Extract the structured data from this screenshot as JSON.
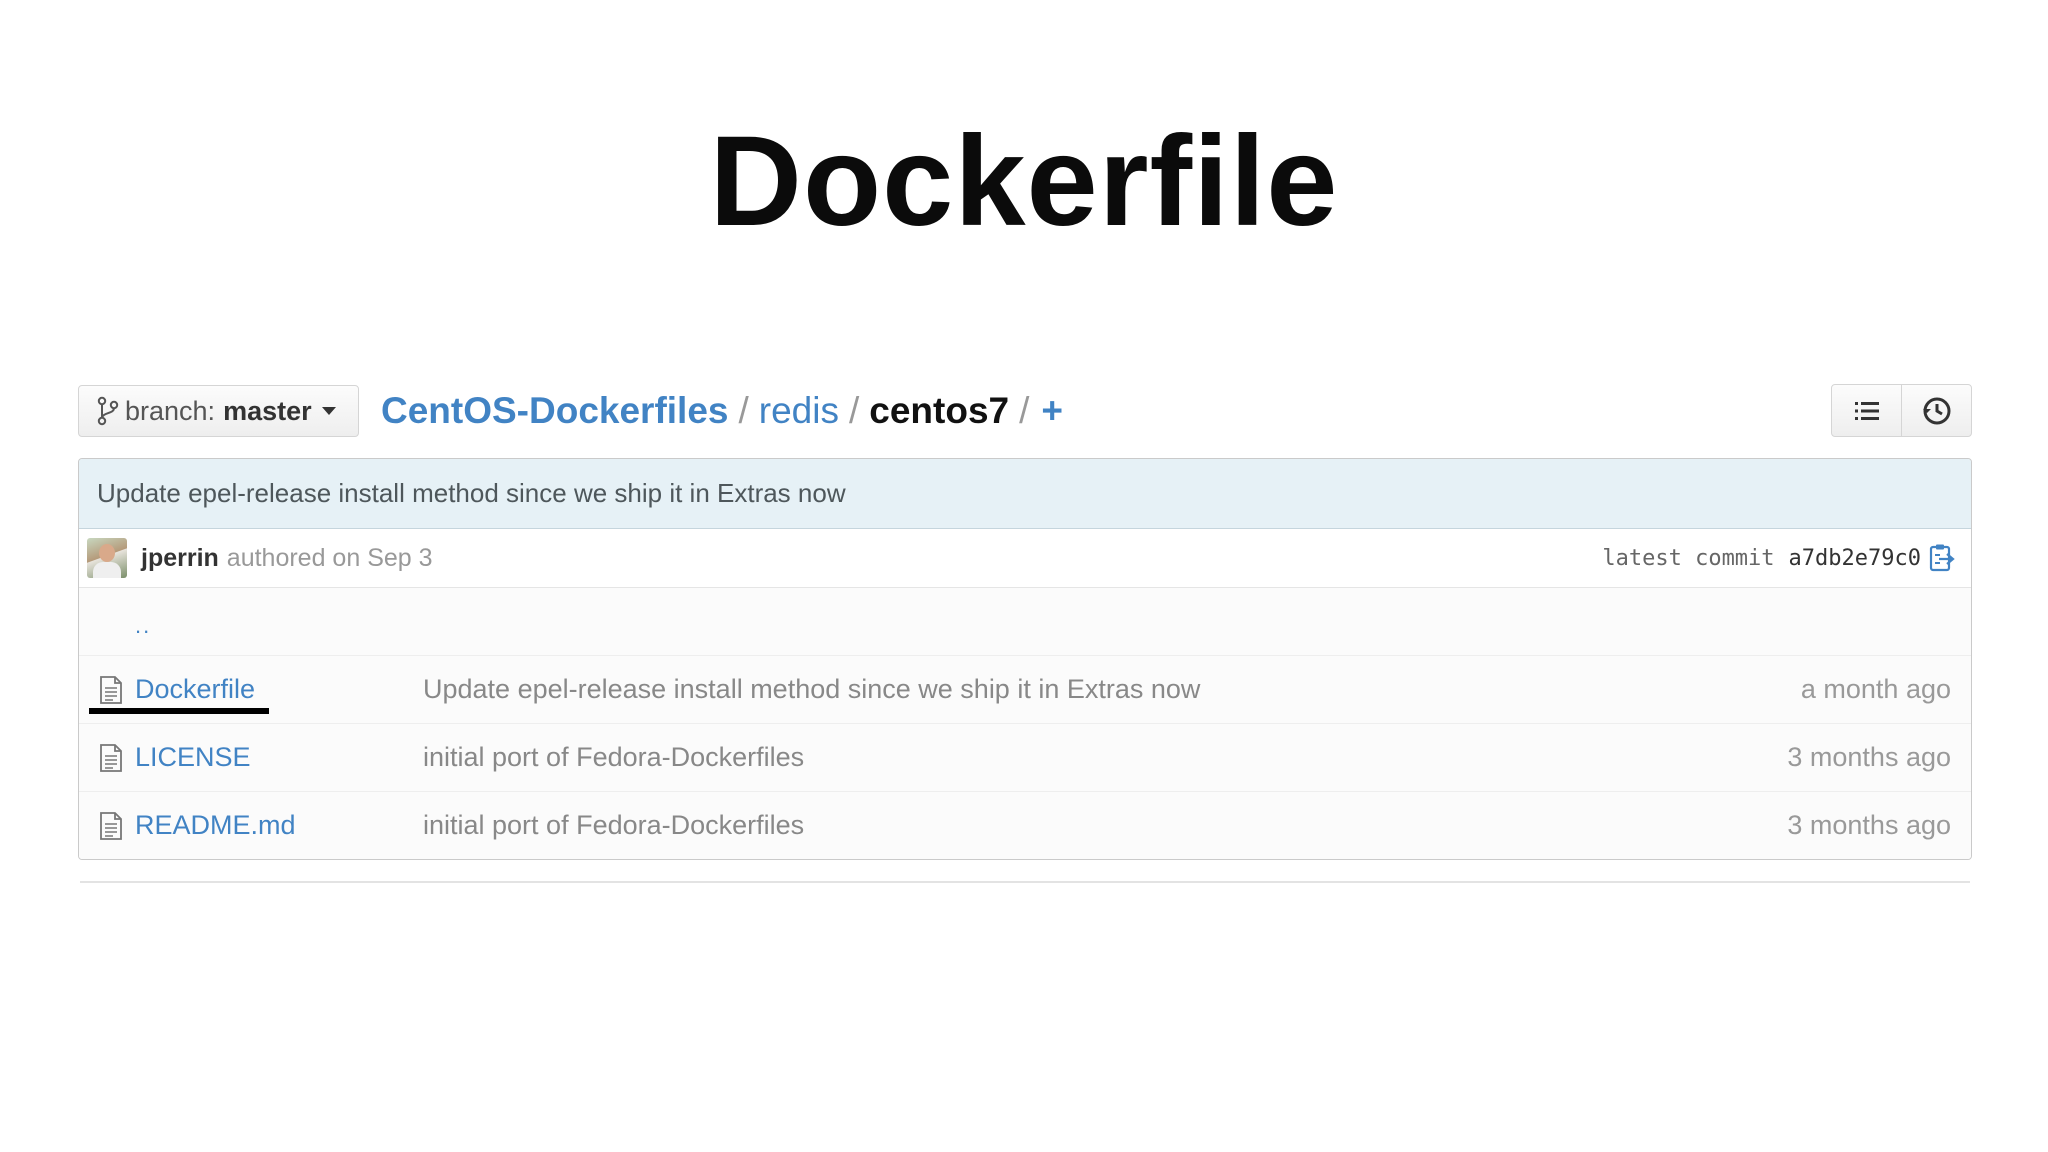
{
  "slide": {
    "title": "Dockerfile"
  },
  "branch": {
    "label": "branch:",
    "name": "master"
  },
  "breadcrumb": {
    "repo": "CentOS-Dockerfiles",
    "folder": "redis",
    "current": "centos7",
    "separator": "/",
    "add": "+"
  },
  "icons": {
    "branch": "git-branch-icon",
    "list_view": "list-icon",
    "history": "history-icon",
    "clipboard": "clipboard-icon",
    "file": "file-text-icon"
  },
  "commit": {
    "title": "Update epel-release install method since we ship it in Extras now",
    "author": "jperrin",
    "authored_text": "authored on Sep 3",
    "latest_label": "latest commit",
    "sha": "a7db2e79c0"
  },
  "files": {
    "up_link": "..",
    "rows": [
      {
        "name": "Dockerfile",
        "message": "Update epel-release install method since we ship it in Extras now",
        "age": "a month ago"
      },
      {
        "name": "LICENSE",
        "message": "initial port of Fedora-Dockerfiles",
        "age": "3 months ago"
      },
      {
        "name": "README.md",
        "message": "initial port of Fedora-Dockerfiles",
        "age": "3 months ago"
      }
    ]
  },
  "colors": {
    "link": "#4183c4",
    "commit_bar": "#e6f1f6",
    "title": "#0b0b0b"
  }
}
